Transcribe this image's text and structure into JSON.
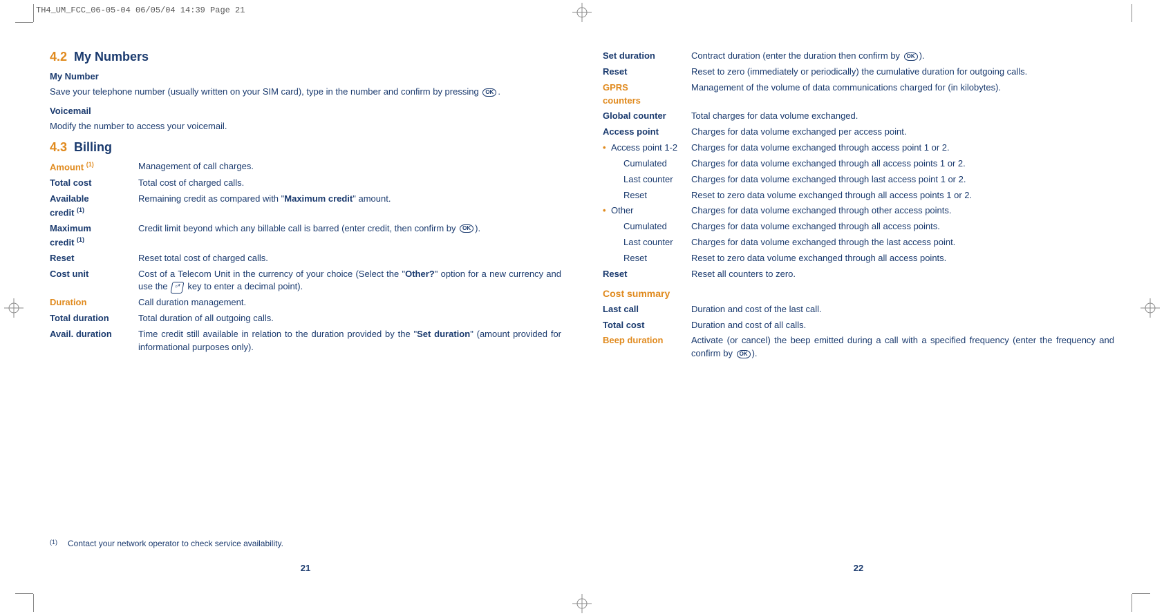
{
  "crop_header": "TH4_UM_FCC_06-05-04  06/05/04  14:39  Page 21",
  "left": {
    "sec42_num": "4.2",
    "sec42_title": "My Numbers",
    "mynum_head": "My Number",
    "mynum_para_a": "Save your telephone number (usually written on your SIM card), type in the number and confirm by pressing ",
    "mynum_para_b": ".",
    "voicemail_head": "Voicemail",
    "voicemail_para": "Modify the number to access your voicemail.",
    "sec43_num": "4.3",
    "sec43_title": "Billing",
    "amount_term": "Amount ",
    "amount_sup": "(1)",
    "amount_desc": "Management of call charges.",
    "total_cost_term": "Total cost",
    "total_cost_desc": "Total cost of charged calls.",
    "avail_credit_term_a": "Available",
    "avail_credit_term_b": "credit ",
    "avail_credit_sup": "(1)",
    "avail_credit_desc_a": "Remaining credit as compared with \"",
    "avail_credit_desc_bold": "Maximum credit",
    "avail_credit_desc_b": "\" amount.",
    "max_credit_term_a": "Maximum",
    "max_credit_term_b": "credit ",
    "max_credit_sup": "(1)",
    "max_credit_desc_a": "Credit limit beyond which any billable call is barred (enter credit, then confirm by ",
    "max_credit_desc_b": ").",
    "reset_term": "Reset",
    "reset_desc": "Reset total cost of charged calls.",
    "cost_unit_term": "Cost unit",
    "cost_unit_desc_a": "Cost of a Telecom Unit in the currency of your choice (Select the \"",
    "cost_unit_desc_bold": "Other?",
    "cost_unit_desc_b": "\" option for a new currency and use the ",
    "cost_unit_desc_c": " key to enter a decimal point).",
    "duration_term": "Duration",
    "duration_desc": "Call duration management.",
    "total_dur_term": "Total duration",
    "total_dur_desc": "Total duration of all outgoing calls.",
    "avail_dur_term": "Avail. duration",
    "avail_dur_desc_a": "Time credit still available in relation to the duration provided by the \"",
    "avail_dur_desc_bold": "Set duration",
    "avail_dur_desc_b": "\" (amount provided for informational purposes only).",
    "footnote_sup": "(1)",
    "footnote_text": "Contact your network operator to check service availability.",
    "pagenum": "21"
  },
  "right": {
    "set_dur_term": "Set duration",
    "set_dur_desc_a": "Contract duration (enter the duration then confirm by ",
    "set_dur_desc_b": ").",
    "reset_term": "Reset",
    "reset_desc": "Reset to zero (immediately or periodically) the cumulative duration for outgoing calls.",
    "gprs_term_a": "GPRS",
    "gprs_term_b": "counters",
    "gprs_desc": "Management of the volume of data communications charged for (in kilobytes).",
    "global_term": "Global counter",
    "global_desc": "Total charges for data volume exchanged.",
    "ap_term": "Access point",
    "ap_desc": "Charges for data volume exchanged per access point.",
    "ap12_term": "Access point 1-2",
    "ap12_desc": "Charges for data volume exchanged through access point 1 or 2.",
    "ap12_cum_term": "Cumulated",
    "ap12_cum_desc": "Charges for data volume exchanged through all access points 1 or 2.",
    "ap12_last_term": "Last counter",
    "ap12_last_desc": "Charges for data volume exchanged through last access point 1 or 2.",
    "ap12_reset_term": "Reset",
    "ap12_reset_desc": "Reset to zero data volume exchanged through all access points 1 or 2.",
    "other_term": "Other",
    "other_desc": "Charges for data volume exchanged through other access points.",
    "other_cum_term": "Cumulated",
    "other_cum_desc": "Charges for data volume exchanged through all access points.",
    "other_last_term": "Last counter",
    "other_last_desc": "Charges for data volume exchanged through the last access point.",
    "other_reset_term": "Reset",
    "other_reset_desc": "Reset to zero data volume exchanged through all access points.",
    "reset_all_term": "Reset",
    "reset_all_desc": "Reset all counters to zero.",
    "summary_head": "Cost summary",
    "last_call_term": "Last call",
    "last_call_desc": "Duration and cost of the last call.",
    "total_cost_term": "Total cost",
    "total_cost_desc": "Duration and cost of all calls.",
    "beep_term": "Beep duration",
    "beep_desc_a": "Activate (or cancel) the beep emitted during a call with a specified frequency (enter the frequency and confirm by ",
    "beep_desc_b": ").",
    "pagenum": "22"
  },
  "icons": {
    "ok": "OK",
    "keypad": "▫*"
  }
}
